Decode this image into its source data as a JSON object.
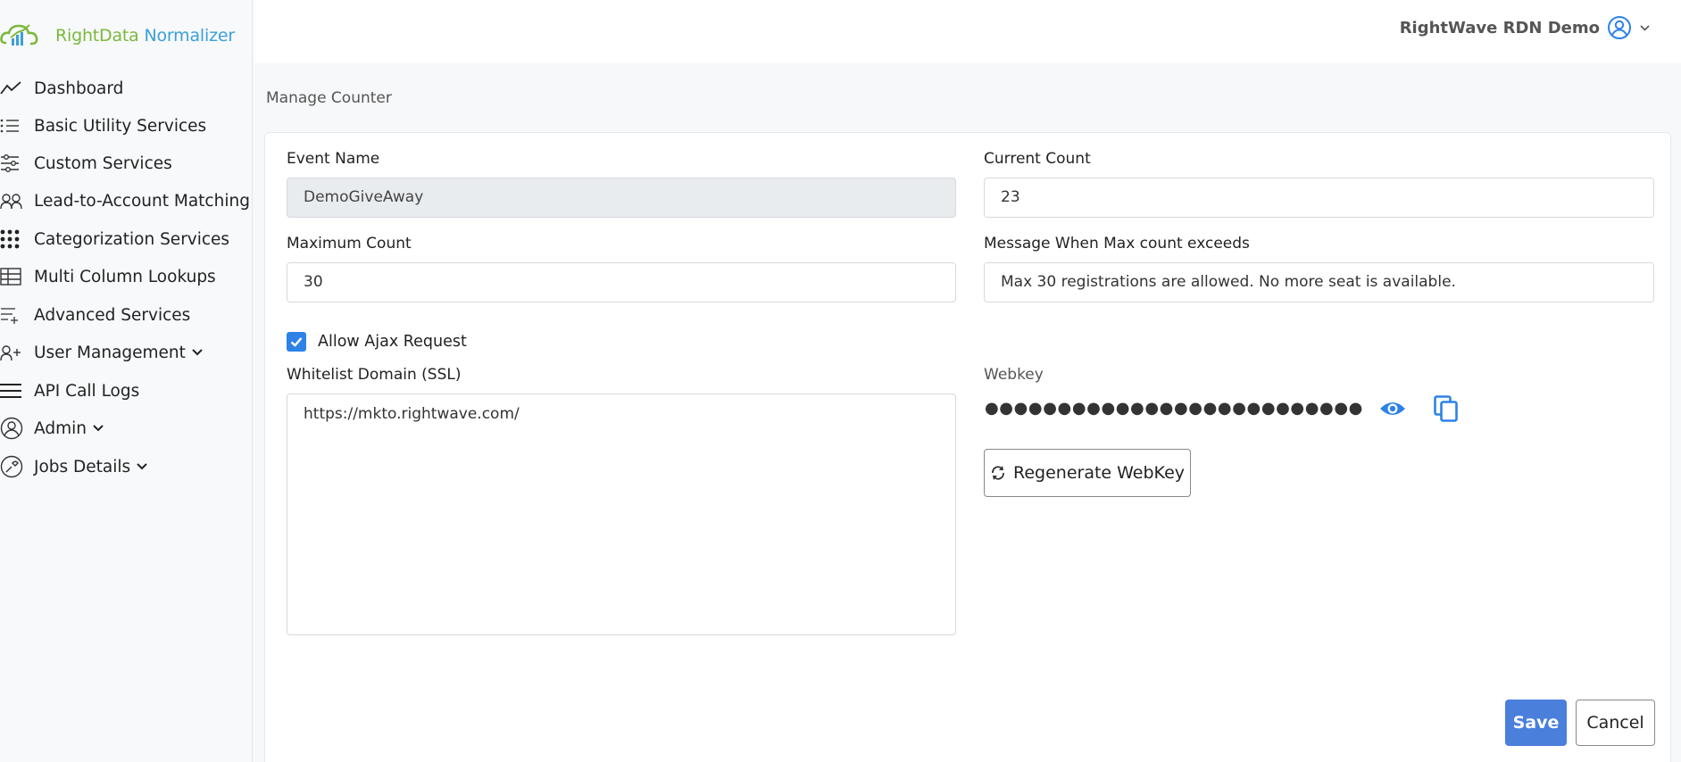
{
  "brand": {
    "name_part1": "RightData",
    "name_part2": "Normalizer",
    "logo_icon": "cloud-chart-logo"
  },
  "sidebar": {
    "items": [
      {
        "label": "Dashboard",
        "icon": "trend-line-icon",
        "has_chevron": false
      },
      {
        "label": "Basic Utility Services",
        "icon": "list-icon",
        "has_chevron": false
      },
      {
        "label": "Custom Services",
        "icon": "sliders-icon",
        "has_chevron": false
      },
      {
        "label": "Lead-to-Account Matching",
        "icon": "users-icon",
        "has_chevron": false
      },
      {
        "label": "Categorization Services",
        "icon": "grid-dots-icon",
        "has_chevron": false
      },
      {
        "label": "Multi Column Lookups",
        "icon": "table-icon",
        "has_chevron": false
      },
      {
        "label": "Advanced Services",
        "icon": "list-plus-icon",
        "has_chevron": false
      },
      {
        "label": "User Management",
        "icon": "user-add-icon",
        "has_chevron": true
      },
      {
        "label": "API Call Logs",
        "icon": "menu-lines-icon",
        "has_chevron": false
      },
      {
        "label": "Admin",
        "icon": "user-circle-icon",
        "has_chevron": true
      },
      {
        "label": "Jobs Details",
        "icon": "wrench-icon",
        "has_chevron": true
      }
    ]
  },
  "header": {
    "user_name": "RightWave RDN Demo",
    "user_icon": "user-circle-icon"
  },
  "page": {
    "title": "Manage Counter"
  },
  "form": {
    "event_name_label": "Event Name",
    "event_name_value": "DemoGiveAway",
    "current_count_label": "Current Count",
    "current_count_value": "23",
    "max_count_label": "Maximum Count",
    "max_count_value": "30",
    "message_label": "Message When Max count exceeds",
    "message_value": "Max 30 registrations are allowed. No more seat is available.",
    "allow_ajax_label": "Allow Ajax Request",
    "allow_ajax_checked": true,
    "whitelist_label": "Whitelist Domain (SSL)",
    "whitelist_value": "https://mkto.rightwave.com/",
    "webkey_label": "Webkey",
    "webkey_masked": "●●●●●●●●●●●●●●●●●●●●●●●●●●",
    "regenerate_label": "Regenerate WebKey",
    "save_label": "Save",
    "cancel_label": "Cancel"
  },
  "colors": {
    "accent": "#2d82e8",
    "brand_green": "#7cb83c",
    "brand_blue": "#3d9fd8",
    "save_bg": "#4a7fdc"
  }
}
